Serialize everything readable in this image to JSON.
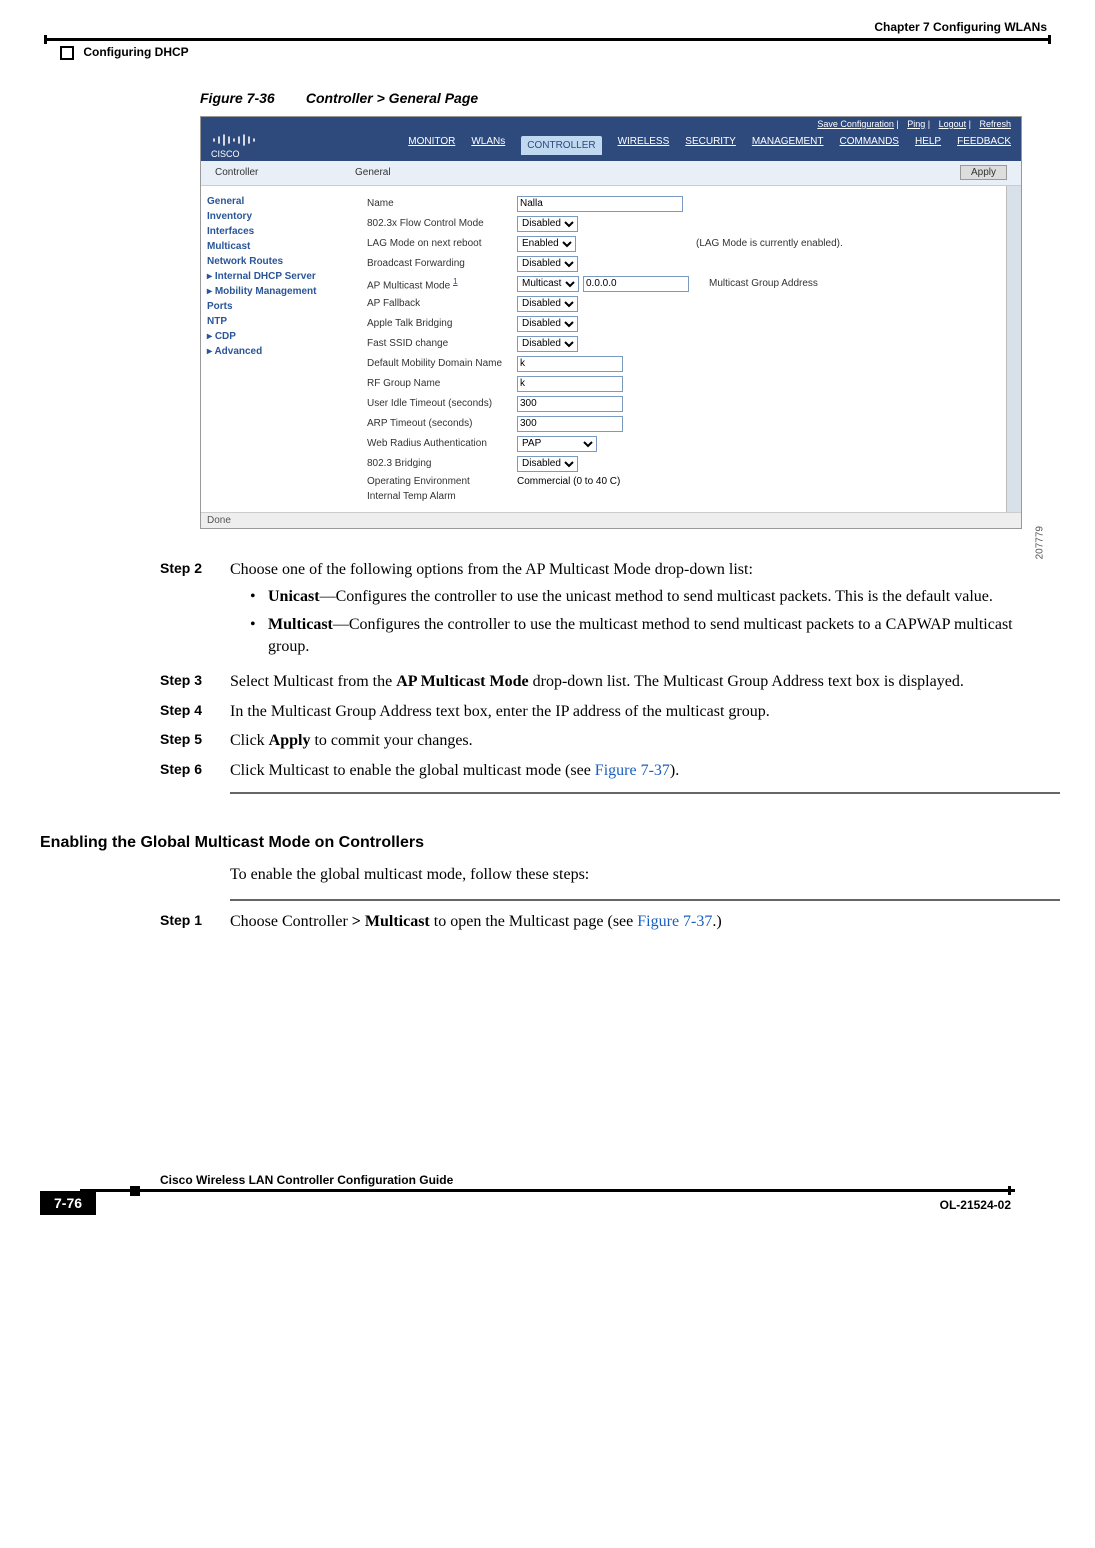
{
  "header": {
    "chapter": "Chapter 7      Configuring WLANs",
    "section": "Configuring DHCP"
  },
  "figure": {
    "label": "Figure 7-36",
    "title": "Controller > General Page",
    "ref": "207779"
  },
  "screenshot": {
    "brand": "CISCO",
    "toplinks": {
      "save": "Save Configuration",
      "ping": "Ping",
      "logout": "Logout",
      "refresh": "Refresh"
    },
    "nav": {
      "monitor": "MONITOR",
      "wlans": "WLANs",
      "controller": "CONTROLLER",
      "wireless": "WIRELESS",
      "security": "SECURITY",
      "management": "MANAGEMENT",
      "commands": "COMMANDS",
      "help": "HELP",
      "feedback": "FEEDBACK"
    },
    "subbar": {
      "left": "Controller",
      "title": "General",
      "apply": "Apply"
    },
    "sidebar": {
      "general": "General",
      "inventory": "Inventory",
      "interfaces": "Interfaces",
      "multicast": "Multicast",
      "routes": "Network Routes",
      "dhcp": "Internal DHCP Server",
      "mobility": "Mobility Management",
      "ports": "Ports",
      "ntp": "NTP",
      "cdp": "CDP",
      "advanced": "Advanced"
    },
    "form": {
      "name_label": "Name",
      "name_value": "Nalla",
      "flow_label": "802.3x Flow Control Mode",
      "flow_value": "Disabled",
      "lag_label": "LAG Mode on next reboot",
      "lag_value": "Enabled",
      "lag_note": "(LAG Mode is currently enabled).",
      "bcast_label": "Broadcast Forwarding",
      "bcast_value": "Disabled",
      "apmc_label": "AP Multicast Mode",
      "apmc_sup": "1",
      "apmc_value": "Multicast",
      "apmc_ip": "0.0.0.0",
      "apmc_note": "Multicast Group Address",
      "apfb_label": "AP Fallback",
      "apfb_value": "Disabled",
      "atb_label": "Apple Talk Bridging",
      "atb_value": "Disabled",
      "ssid_label": "Fast SSID change",
      "ssid_value": "Disabled",
      "mob_label": "Default Mobility Domain Name",
      "mob_value": "k",
      "rf_label": "RF Group Name",
      "rf_value": "k",
      "idle_label": "User Idle Timeout (seconds)",
      "idle_value": "300",
      "arp_label": "ARP Timeout (seconds)",
      "arp_value": "300",
      "radius_label": "Web Radius Authentication",
      "radius_value": "PAP",
      "bridge_label": "802.3 Bridging",
      "bridge_value": "Disabled",
      "env_label": "Operating Environment",
      "env_value": "Commercial (0 to 40 C)",
      "temp_label": "Internal Temp Alarm"
    },
    "status": "Done"
  },
  "steps": {
    "s2_label": "Step 2",
    "s2_text": "Choose one of the following options from the AP Multicast Mode drop-down list:",
    "b1_strong": "Unicast",
    "b1_text": "—Configures the controller to use the unicast method to send multicast packets. This is the default value.",
    "b2_strong": "Multicast",
    "b2_text": "—Configures the controller to use the multicast method to send multicast packets to a CAPWAP multicast group.",
    "s3_label": "Step 3",
    "s3_text_a": "Select Multicast from the ",
    "s3_bold": "AP Multicast Mode",
    "s3_text_b": " drop-down list. The Multicast Group Address text box is displayed.",
    "s4_label": "Step 4",
    "s4_text": "In the Multicast Group Address text box, enter the IP address of the multicast group.",
    "s5_label": "Step 5",
    "s5_text_a": "Click ",
    "s5_bold": "Apply",
    "s5_text_b": " to commit your changes.",
    "s6_label": "Step 6",
    "s6_text_a": "Click Multicast to enable the global multicast mode (see ",
    "s6_link": "Figure 7-37",
    "s6_text_b": ")."
  },
  "subsection": {
    "title": "Enabling the Global Multicast Mode on Controllers",
    "intro": "To enable the global multicast mode, follow these steps:",
    "s1_label": "Step 1",
    "s1_text_a": "Choose Controller ",
    "s1_bold": "> Multicast",
    "s1_text_b": " to open the Multicast page (see ",
    "s1_link": "Figure 7-37",
    "s1_text_c": ".)"
  },
  "footer": {
    "title": "Cisco Wireless LAN Controller Configuration Guide",
    "page": "7-76",
    "doc": "OL-21524-02"
  }
}
